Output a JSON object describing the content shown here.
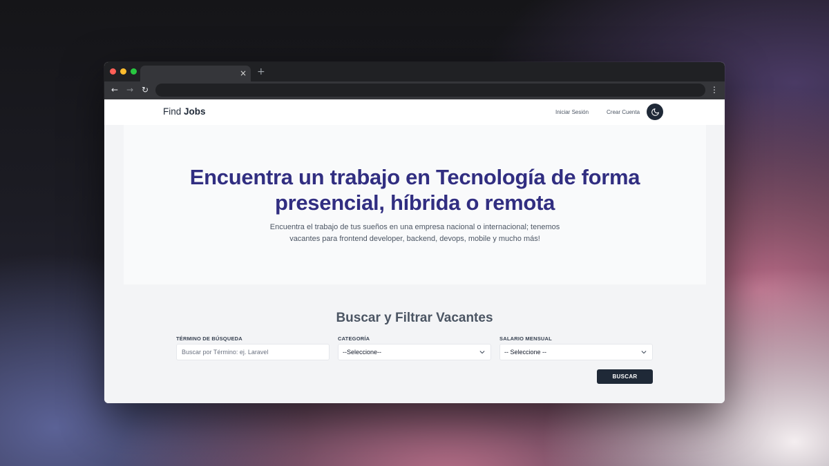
{
  "browser": {
    "tab_close": "×",
    "new_tab": "+",
    "back_icon": "arrow-left-icon",
    "forward_icon": "arrow-right-icon",
    "reload_icon": "reload-icon",
    "menu_icon": "kebab-menu-icon"
  },
  "site": {
    "brand_light": "Find",
    "brand_bold": "Jobs",
    "nav": {
      "login": "Iniciar Sesión",
      "signup": "Crear Cuenta",
      "theme_icon": "moon-icon"
    }
  },
  "hero": {
    "title_line1": "Encuentra un trabajo en Tecnología de forma",
    "title_line2": "presencial, híbrida o remota",
    "subtitle_line1": "Encuentra el trabajo de tus sueños en una empresa nacional o internacional; tenemos",
    "subtitle_line2": "vacantes para frontend developer, backend, devops, mobile y mucho más!"
  },
  "filters": {
    "title": "Buscar y Filtrar Vacantes",
    "term_label": "TÉRMINO DE BÚSQUEDA",
    "term_placeholder": "Buscar por Término: ej. Laravel",
    "category_label": "CATEGORÍA",
    "category_value": "--Seleccione--",
    "salary_label": "SALARIO MENSUAL",
    "salary_value": "-- Seleccione --",
    "submit": "BUSCAR"
  },
  "colors": {
    "accent": "#312e81",
    "button": "#1f2937"
  }
}
